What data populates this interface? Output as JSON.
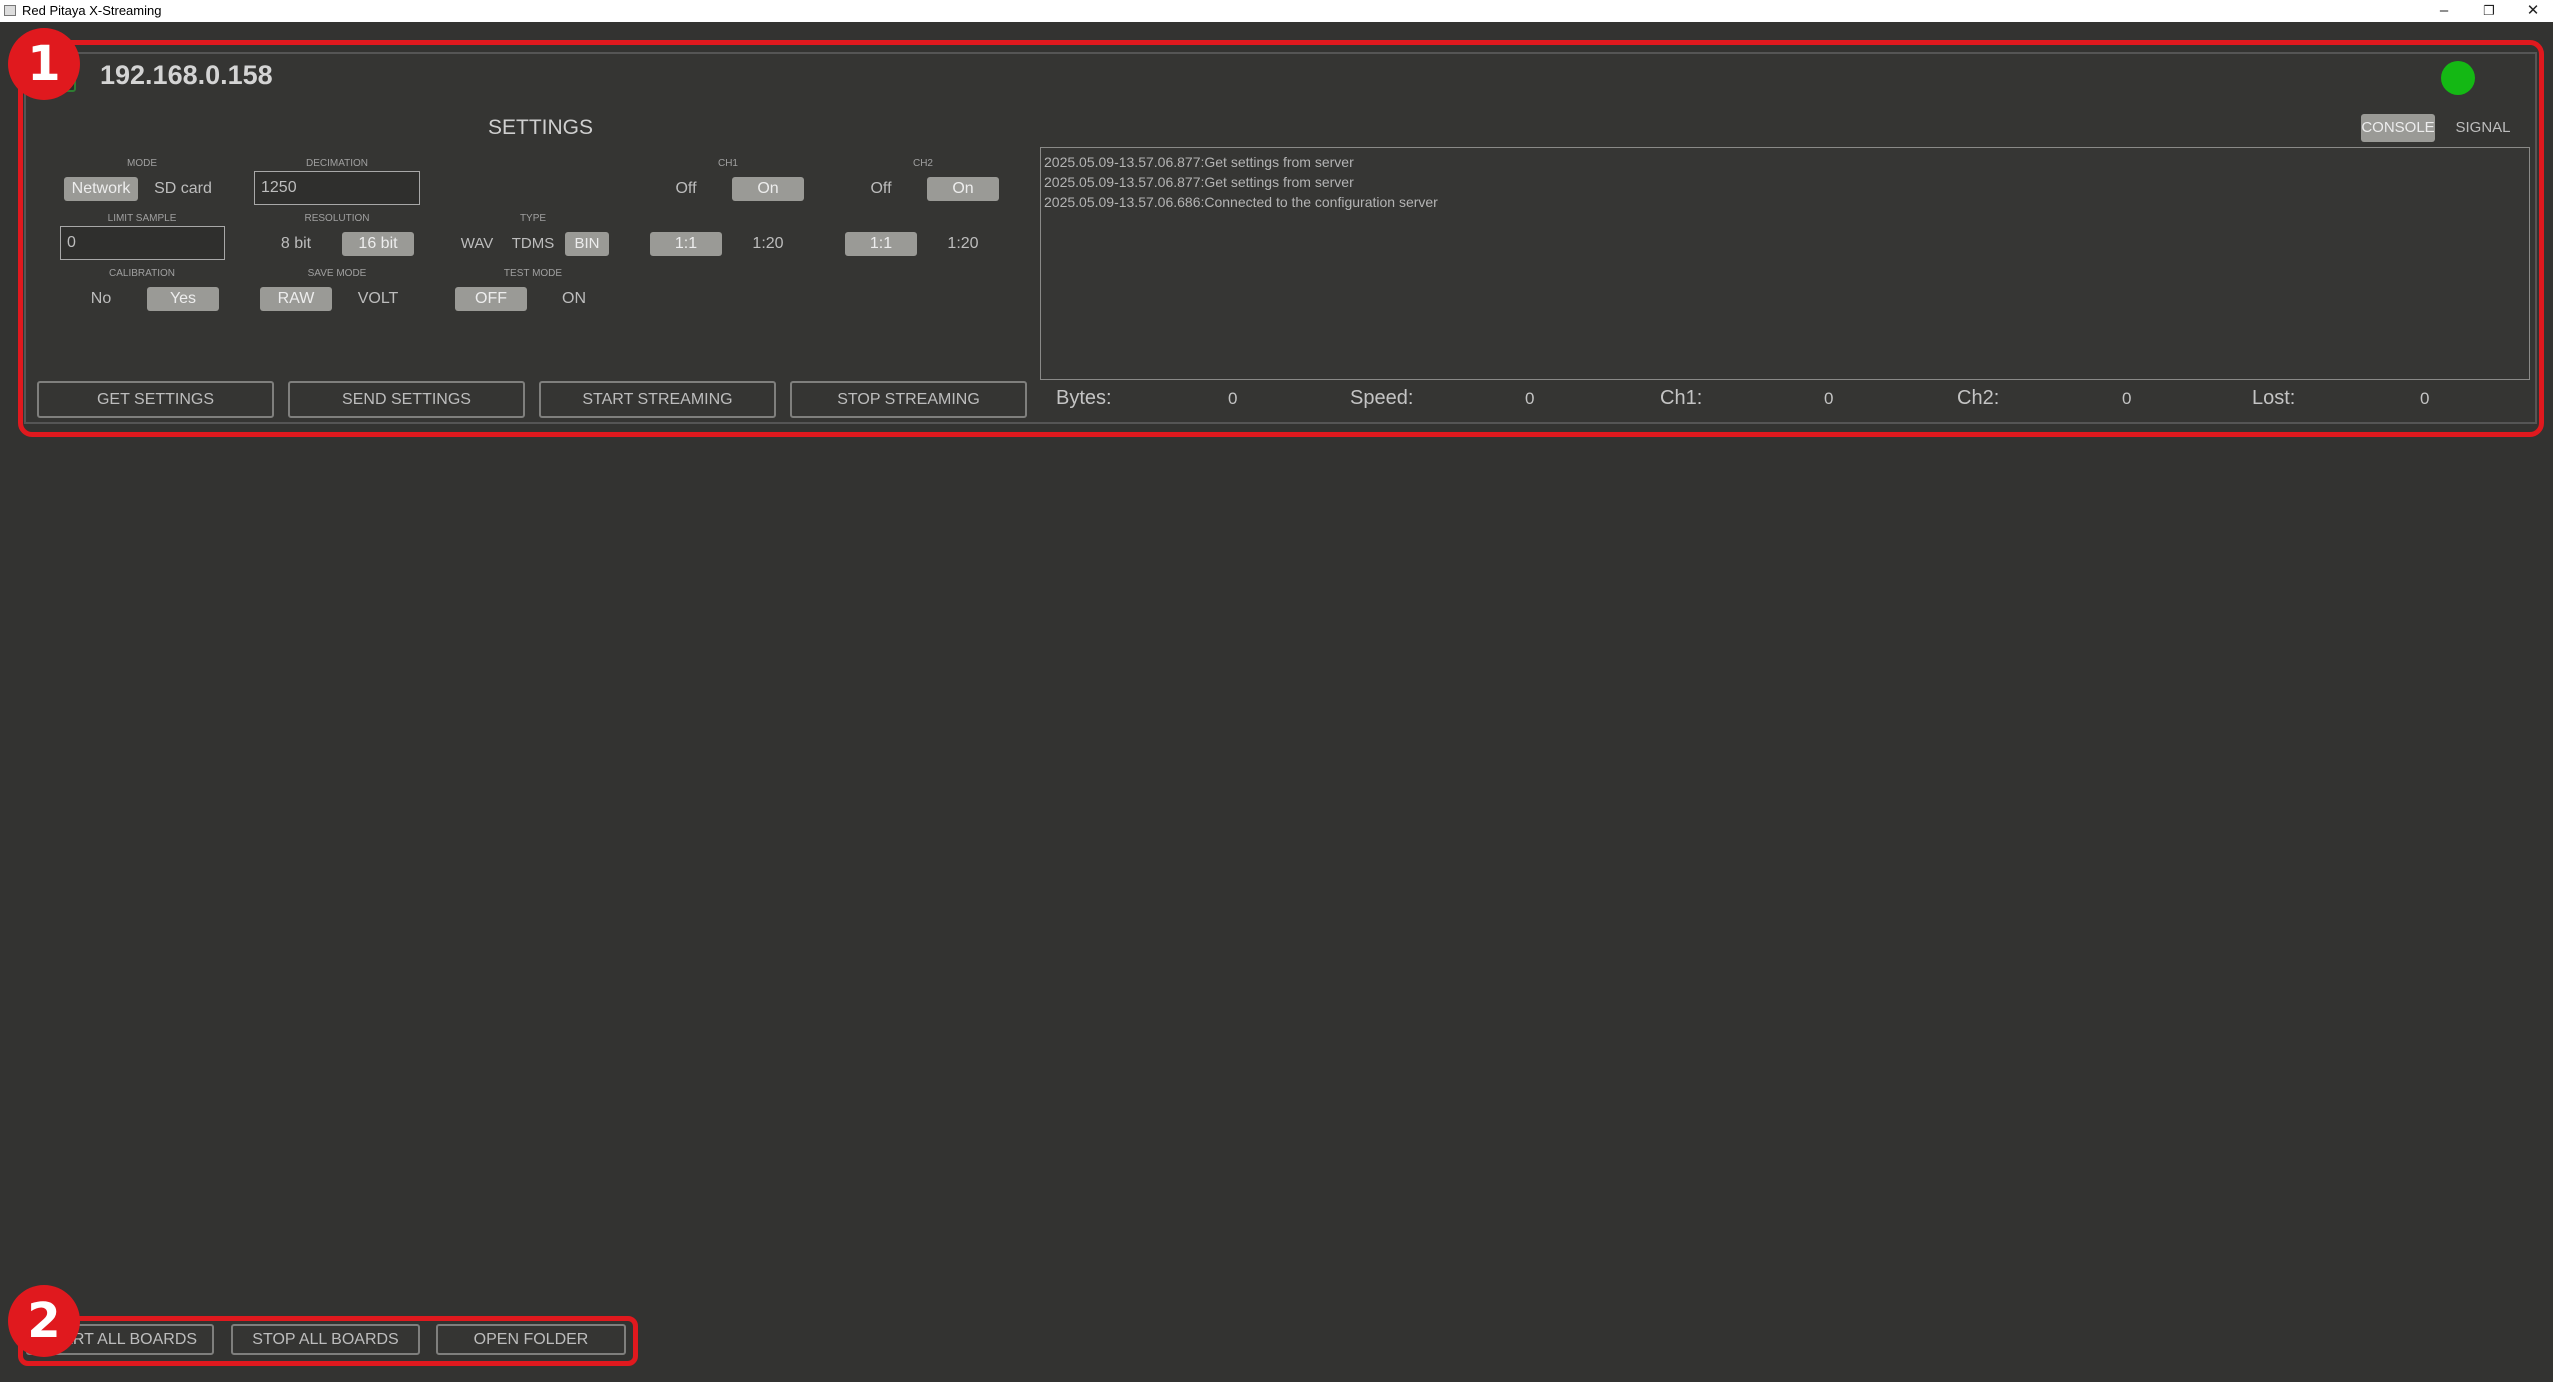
{
  "window": {
    "title": "Red Pitaya X-Streaming"
  },
  "board": {
    "ip": "192.168.0.158",
    "settings_title": "SETTINGS",
    "mode": {
      "label": "MODE",
      "options": [
        "Network",
        "SD card"
      ],
      "selected": "Network"
    },
    "decimation": {
      "label": "DECIMATION",
      "value": "1250"
    },
    "limit_sample": {
      "label": "LIMIT SAMPLE",
      "value": "0"
    },
    "resolution": {
      "label": "RESOLUTION",
      "options": [
        "8 bit",
        "16 bit"
      ],
      "selected": "16 bit"
    },
    "type": {
      "label": "TYPE",
      "options": [
        "WAV",
        "TDMS",
        "BIN"
      ],
      "selected": "BIN"
    },
    "calibration": {
      "label": "CALIBRATION",
      "options": [
        "No",
        "Yes"
      ],
      "selected": "Yes"
    },
    "save_mode": {
      "label": "SAVE MODE",
      "options": [
        "RAW",
        "VOLT"
      ],
      "selected": "RAW"
    },
    "test_mode": {
      "label": "TEST MODE",
      "options": [
        "OFF",
        "ON"
      ],
      "selected": "OFF"
    },
    "ch1": {
      "label": "CH1",
      "state_options": [
        "Off",
        "On"
      ],
      "state": "On",
      "atten_options": [
        "1:1",
        "1:20"
      ],
      "atten": "1:1"
    },
    "ch2": {
      "label": "CH2",
      "state_options": [
        "Off",
        "On"
      ],
      "state": "On",
      "atten_options": [
        "1:1",
        "1:20"
      ],
      "atten": "1:1"
    },
    "view_tabs": {
      "console": "CONSOLE",
      "signal": "SIGNAL",
      "selected": "CONSOLE"
    },
    "console_lines": [
      "2025.05.09-13.57.06.877:Get settings from server",
      "2025.05.09-13.57.06.877:Get settings from server",
      "2025.05.09-13.57.06.686:Connected to the configuration server"
    ],
    "buttons": {
      "get_settings": "GET SETTINGS",
      "send_settings": "SEND SETTINGS",
      "start_streaming": "START STREAMING",
      "stop_streaming": "STOP STREAMING"
    },
    "stats": {
      "bytes_label": "Bytes:",
      "bytes": "0",
      "speed_label": "Speed:",
      "speed": "0",
      "ch1_label": "Ch1:",
      "ch1": "0",
      "ch2_label": "Ch2:",
      "ch2": "0",
      "lost_label": "Lost:",
      "lost": "0"
    },
    "status_color": "#14b814"
  },
  "footer": {
    "start_all": "START ALL BOARDS",
    "stop_all": "STOP ALL BOARDS",
    "open_folder": "OPEN FOLDER"
  },
  "annotations": {
    "marker1": "1",
    "marker2": "2",
    "highlight_color": "#e0191e"
  }
}
